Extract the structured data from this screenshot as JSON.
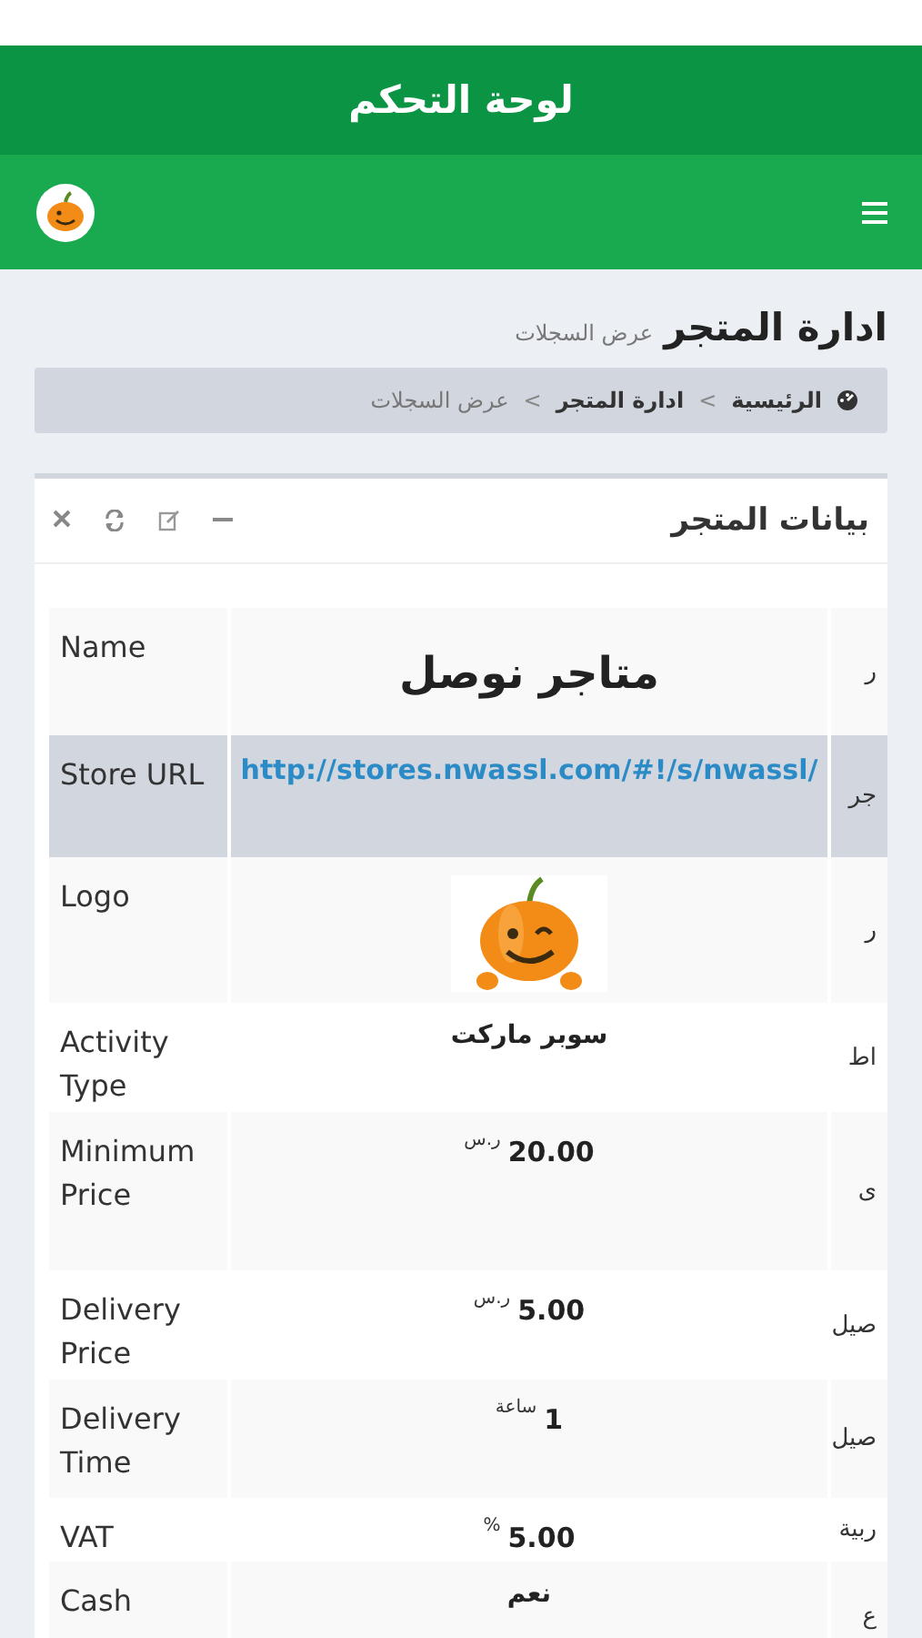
{
  "app_bar": {
    "title": "لوحة التحكم"
  },
  "page_header": {
    "title": "ادارة المتجر",
    "subtitle": "عرض السجلات"
  },
  "breadcrumb": [
    {
      "label": "الرئيسية",
      "current": false
    },
    {
      "label": "ادارة المتجر",
      "current": false
    },
    {
      "label": "عرض السجلات",
      "current": true
    }
  ],
  "breadcrumb_separator": ">",
  "card": {
    "title": "بيانات المتجر"
  },
  "rows": [
    {
      "label": "Name",
      "kind": "title",
      "value": "متاجر نوصل",
      "column_3": "ر",
      "highlighted": false
    },
    {
      "label": "Store URL",
      "kind": "link",
      "value": "http://stores.nwassl.com/#!/s/nwassl/",
      "column_3": "جر",
      "highlighted": true
    },
    {
      "label": "Logo",
      "kind": "image",
      "column_3": "ر",
      "highlighted": false
    },
    {
      "label": "Activity Type",
      "kind": "text",
      "value": "سوبر ماركت",
      "column_3": "اط",
      "highlighted": false
    },
    {
      "label": "Minimum Price",
      "kind": "amount",
      "value": "20.00",
      "unit": "ر.س",
      "column_3": "ى",
      "highlighted": false
    },
    {
      "label": "Delivery Price",
      "kind": "amount",
      "value": "5.00",
      "unit": "ر.س",
      "column_3": "صيل",
      "highlighted": false
    },
    {
      "label": "Delivery Time",
      "kind": "amount",
      "value": "1",
      "unit": "ساعة",
      "column_3": "صيل",
      "highlighted": false
    },
    {
      "label": "VAT",
      "kind": "amount",
      "value": "5.00",
      "unit": "%",
      "column_3": "ربية",
      "highlighted": false
    },
    {
      "label": "Cash",
      "kind": "text",
      "value": "نعم",
      "column_3": "ع",
      "highlighted": false
    }
  ]
}
